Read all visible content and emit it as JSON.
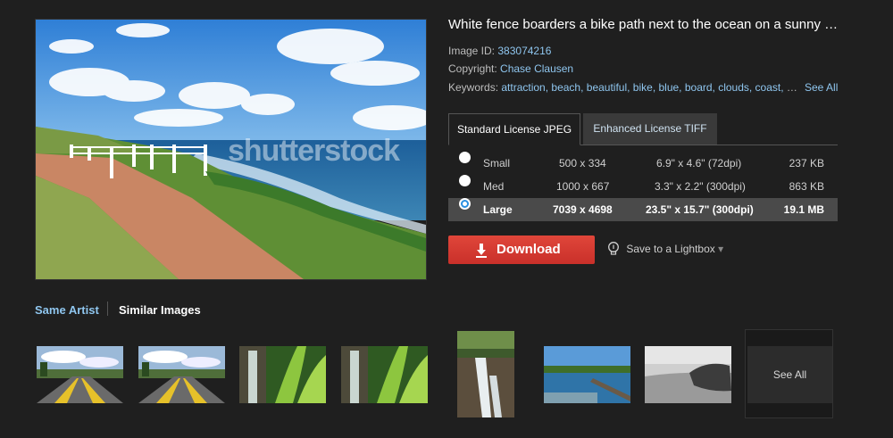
{
  "image": {
    "title": "White fence boarders a bike path next to the ocean on a sunny d...",
    "watermark": "shutterstock",
    "id_label": "Image ID:",
    "id_value": "383074216",
    "copyright_label": "Copyright:",
    "copyright_value": "Chase Clausen",
    "keywords_label": "Keywords:",
    "keywords_value": "attraction, beach, beautiful, bike, blue, board, clouds, coast, co...",
    "see_all": "See All"
  },
  "license_tabs": [
    {
      "label": "Standard License JPEG",
      "active": true
    },
    {
      "label": "Enhanced License TIFF",
      "active": false
    }
  ],
  "sizes": [
    {
      "name": "Small",
      "pixels": "500 x 334",
      "print": "6.9\" x 4.6\"  (72dpi)",
      "filesize": "237 KB",
      "selected": false
    },
    {
      "name": "Med",
      "pixels": "1000 x 667",
      "print": "3.3\" x 2.2\"  (300dpi)",
      "filesize": "863 KB",
      "selected": false
    },
    {
      "name": "Large",
      "pixels": "7039 x 4698",
      "print": "23.5\" x 15.7\"  (300dpi)",
      "filesize": "19.1 MB",
      "selected": true
    }
  ],
  "actions": {
    "download": "Download",
    "lightbox": "Save to a Lightbox",
    "lightbox_caret": "▾"
  },
  "related": {
    "same_artist": "Same Artist",
    "similar_images": "Similar Images",
    "see_all": "See All"
  },
  "colors": {
    "background": "#1f1f1f",
    "link": "#8fc6ef",
    "download": "#d33b30",
    "selected_row": "#4a4a4a",
    "radio_selected": "#2a8fe0"
  },
  "icons": {
    "download": "download-arrow-icon",
    "lightbox": "lightbulb-icon",
    "radio": "radio-button-icon"
  }
}
